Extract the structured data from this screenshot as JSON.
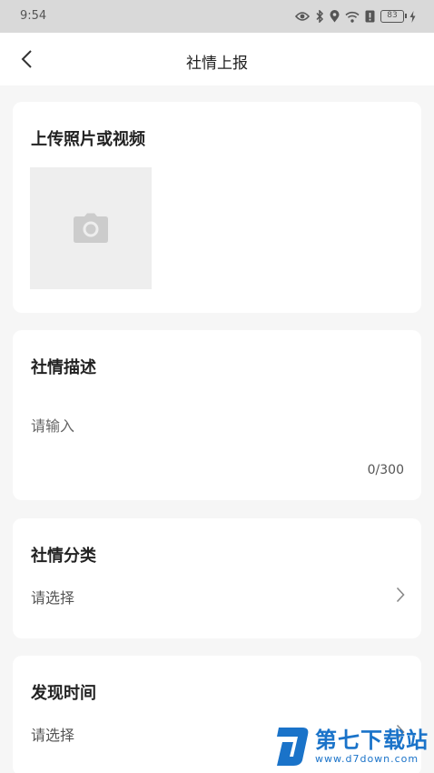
{
  "status_bar": {
    "time": "9:54",
    "battery": "83"
  },
  "nav": {
    "title": "社情上报"
  },
  "upload": {
    "title": "上传照片或视频"
  },
  "description": {
    "title": "社情描述",
    "placeholder": "请输入",
    "counter": "0/300"
  },
  "category": {
    "title": "社情分类",
    "placeholder": "请选择"
  },
  "time_found": {
    "title": "发现时间",
    "placeholder": "请选择"
  },
  "watermark": {
    "name": "第七下载站",
    "url": "www.d7down.com"
  }
}
